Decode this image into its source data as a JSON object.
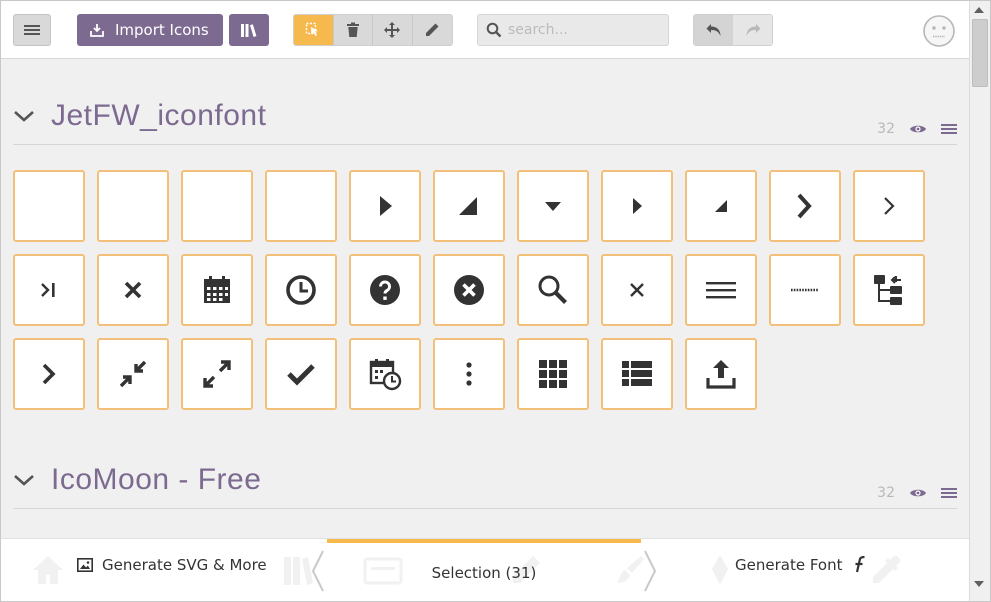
{
  "toolbar": {
    "import_label": "Import Icons",
    "search_placeholder": "search..."
  },
  "sets": [
    {
      "name": "JetFW_iconfont",
      "count": "32"
    },
    {
      "name": "IcoMoon - Free",
      "count": "32"
    }
  ],
  "icons": [
    "blank",
    "blank",
    "blank",
    "blank",
    "triangle-right",
    "triangle-corner",
    "triangle-down",
    "triangle-right-small",
    "triangle-corner-small",
    "chevron-right-bold",
    "chevron-right-thin",
    "skip-end",
    "close-bold",
    "calendar",
    "clock",
    "help-circle",
    "close-circle",
    "search",
    "close-thin",
    "menu-lines",
    "dotted-line",
    "tree-structure",
    "chevron-right",
    "compress",
    "expand",
    "checkmark",
    "calendar-clock",
    "more-vertical",
    "grid-view",
    "list-view",
    "upload"
  ],
  "footer": {
    "generate_svg_label": "Generate SVG & More",
    "selection_label": "Selection (31)",
    "generate_font_label": "Generate Font"
  },
  "colors": {
    "accent_purple": "#7d6a90",
    "selection_orange": "#f6b94e",
    "icon_border": "#f3c07a",
    "icon_fill": "#333333"
  }
}
